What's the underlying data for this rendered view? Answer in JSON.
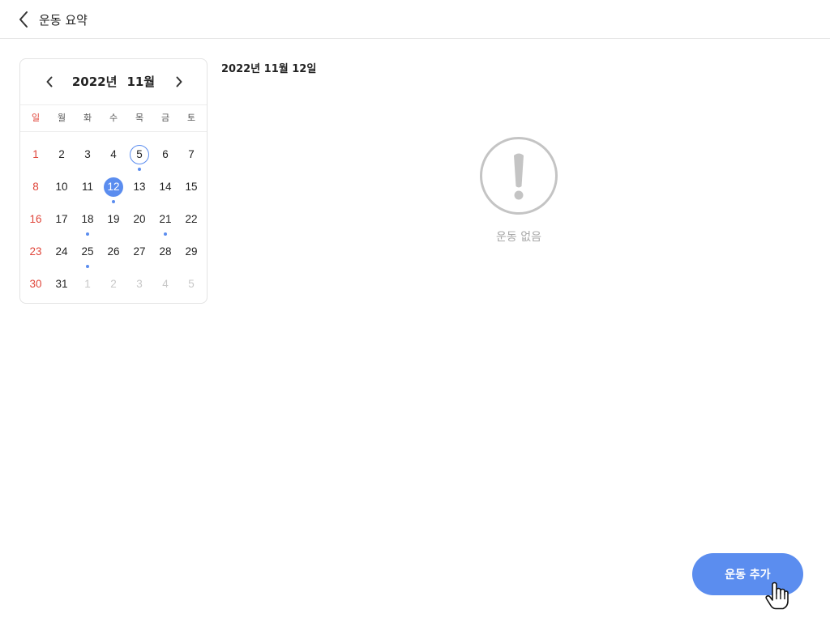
{
  "header": {
    "title": "운동 요약",
    "back_icon": "chevron-left-icon"
  },
  "calendar": {
    "year_label": "2022년",
    "month_label": "11월",
    "prev_icon": "chevron-left-icon",
    "next_icon": "chevron-right-icon",
    "weekdays": [
      "일",
      "월",
      "화",
      "수",
      "목",
      "금",
      "토"
    ],
    "weeks": [
      [
        {
          "d": "1"
        },
        {
          "d": "2"
        },
        {
          "d": "3"
        },
        {
          "d": "4"
        },
        {
          "d": "5",
          "today": true,
          "dot": true
        },
        {
          "d": "6"
        },
        {
          "d": "7"
        }
      ],
      [
        {
          "d": "8"
        },
        {
          "d": "10"
        },
        {
          "d": "11"
        },
        {
          "d": "12",
          "selected": true,
          "dot": true
        },
        {
          "d": "13"
        },
        {
          "d": "14"
        },
        {
          "d": "15"
        }
      ],
      [
        {
          "d": "16"
        },
        {
          "d": "17"
        },
        {
          "d": "18",
          "dot": true
        },
        {
          "d": "19"
        },
        {
          "d": "20"
        },
        {
          "d": "21",
          "dot": true
        },
        {
          "d": "22"
        }
      ],
      [
        {
          "d": "23"
        },
        {
          "d": "24"
        },
        {
          "d": "25",
          "dot": true
        },
        {
          "d": "26"
        },
        {
          "d": "27"
        },
        {
          "d": "28"
        },
        {
          "d": "29"
        }
      ],
      [
        {
          "d": "30"
        },
        {
          "d": "31"
        },
        {
          "d": "1",
          "other": true
        },
        {
          "d": "2",
          "other": true
        },
        {
          "d": "3",
          "other": true
        },
        {
          "d": "4",
          "other": true
        },
        {
          "d": "5",
          "other": true
        }
      ]
    ]
  },
  "main": {
    "selected_date": "2022년 11월 12일",
    "empty_icon": "exclamation-circle-icon",
    "empty_text": "운동 없음"
  },
  "fab": {
    "label": "운동 추가"
  },
  "colors": {
    "accent": "#5b8def",
    "sunday": "#e0463b",
    "muted": "#a8a8a8"
  }
}
